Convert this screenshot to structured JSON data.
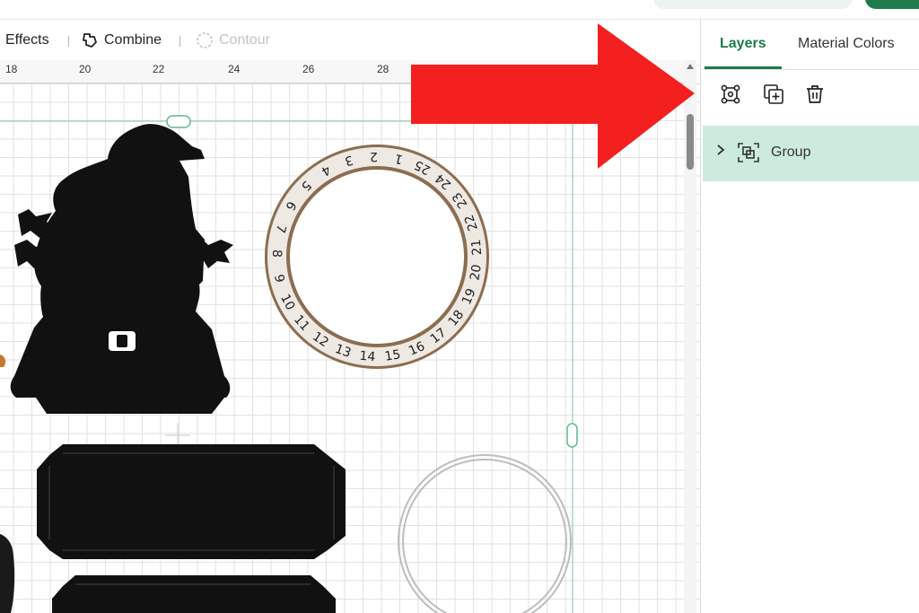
{
  "toolbar": {
    "effects_label": "Effects",
    "combine_label": "Combine",
    "contour_label": "Contour"
  },
  "ruler": {
    "labels": [
      "18",
      "20",
      "22",
      "24",
      "26",
      "28"
    ]
  },
  "canvas": {
    "dial_numbers": [
      "1",
      "2",
      "3",
      "4",
      "5",
      "6",
      "7",
      "8",
      "9",
      "10",
      "11",
      "12",
      "13",
      "14",
      "15",
      "16",
      "17",
      "18",
      "19",
      "20",
      "21",
      "22",
      "23",
      "24",
      "25"
    ]
  },
  "panel": {
    "tabs": [
      {
        "label": "Layers",
        "active": true
      },
      {
        "label": "Material Colors",
        "active": false
      }
    ],
    "actions": [
      "ungroup-icon",
      "duplicate-icon",
      "delete-icon"
    ],
    "layers": [
      {
        "label": "Group",
        "icon": "group-icon",
        "selected": true
      }
    ]
  },
  "colors": {
    "accent": "#1e7a4c",
    "selection": "#cdebdd",
    "arrow": "#f41f1f",
    "dial_ring": "#8b6e50",
    "dial_fill": "#efe9e4"
  }
}
